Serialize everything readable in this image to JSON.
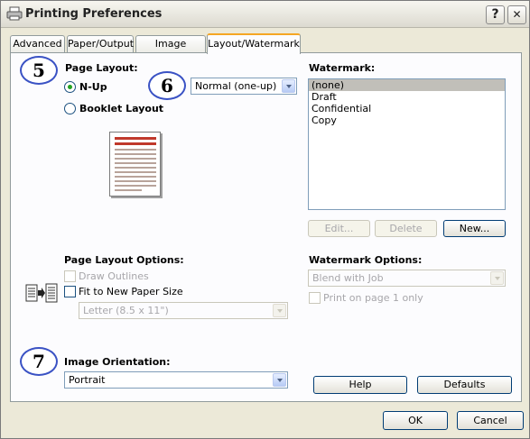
{
  "window": {
    "title": "Printing Preferences",
    "help_button": "?",
    "close_button": "✕"
  },
  "tabs": [
    {
      "label": "Advanced",
      "active": false
    },
    {
      "label": "Paper/Output",
      "active": false
    },
    {
      "label": "Image Options",
      "active": false
    },
    {
      "label": "Layout/Watermark",
      "active": true
    }
  ],
  "callouts": {
    "a": "5",
    "b": "6",
    "c": "7"
  },
  "page_layout": {
    "heading": "Page Layout:",
    "nup_label": "N-Up",
    "booklet_label": "Booklet Layout",
    "selected": "N-Up",
    "nup_select_value": "Normal (one-up)"
  },
  "watermark": {
    "heading": "Watermark:",
    "items": [
      "(none)",
      "Draft",
      "Confidential",
      "Copy"
    ],
    "selected": "(none)",
    "edit_button": "Edit...",
    "delete_button": "Delete",
    "new_button": "New..."
  },
  "layout_options": {
    "heading": "Page Layout Options:",
    "draw_outlines": "Draw Outlines",
    "fit_to_paper": "Fit to New Paper Size",
    "paper_select_value": "Letter (8.5 x 11\")"
  },
  "watermark_options": {
    "heading": "Watermark Options:",
    "blend_select_value": "Blend with Job",
    "print_first_page": "Print on page 1 only"
  },
  "orientation": {
    "heading": "Image Orientation:",
    "select_value": "Portrait"
  },
  "panel_buttons": {
    "help": "Help",
    "defaults": "Defaults"
  },
  "dialog_buttons": {
    "ok": "OK",
    "cancel": "Cancel"
  },
  "colors": {
    "accent_tab": "#f5a623",
    "radio_dot": "#21a121",
    "callout_ring": "#3a52c4",
    "selection": "#c1bfb9"
  }
}
